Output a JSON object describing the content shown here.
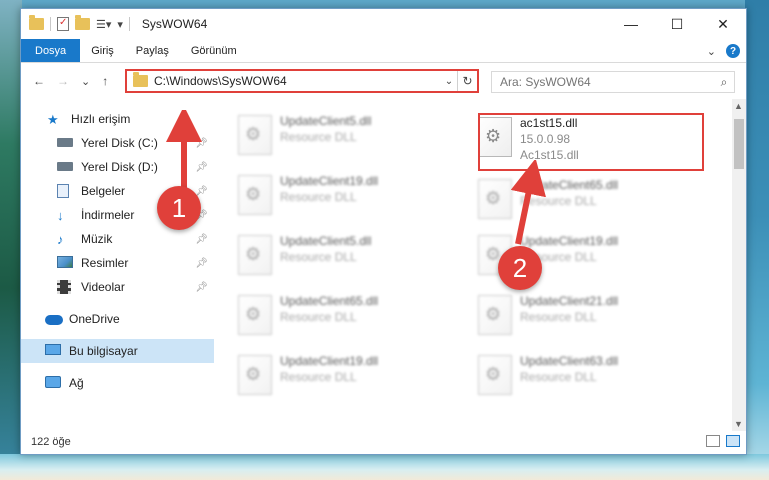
{
  "window": {
    "title": "SysWOW64",
    "controls": {
      "minimize": "—",
      "maximize": "☐",
      "close": "✕"
    }
  },
  "ribbon": {
    "tabs": [
      "Dosya",
      "Giriş",
      "Paylaş",
      "Görünüm"
    ]
  },
  "address": {
    "path": "C:\\Windows\\SysWOW64",
    "search_placeholder": "Ara: SysWOW64"
  },
  "navpane": {
    "items": [
      {
        "label": "Hızlı erişim",
        "icon": "star-icon",
        "pinned": false
      },
      {
        "label": "Yerel Disk (C:)",
        "icon": "drive-icon",
        "pinned": true
      },
      {
        "label": "Yerel Disk (D:)",
        "icon": "drive-icon",
        "pinned": true
      },
      {
        "label": "Belgeler",
        "icon": "documents-icon",
        "pinned": true
      },
      {
        "label": "İndirmeler",
        "icon": "download-icon",
        "pinned": true
      },
      {
        "label": "Müzik",
        "icon": "music-icon",
        "pinned": true
      },
      {
        "label": "Resimler",
        "icon": "pictures-icon",
        "pinned": true
      },
      {
        "label": "Videolar",
        "icon": "video-icon",
        "pinned": true
      },
      {
        "label": "OneDrive",
        "icon": "onedrive-icon",
        "pinned": false
      },
      {
        "label": "Bu bilgisayar",
        "icon": "this-pc-icon",
        "pinned": false,
        "selected": true
      },
      {
        "label": "Ağ",
        "icon": "network-icon",
        "pinned": false
      }
    ]
  },
  "files": {
    "left_column": [
      {
        "name": "UpdateClient5.dll",
        "type": "Resource DLL"
      },
      {
        "name": "UpdateClient19.dll",
        "type": "Resource DLL"
      },
      {
        "name": "UpdateClient5.dll",
        "type": "Resource DLL"
      },
      {
        "name": "UpdateClient65.dll",
        "type": "Resource DLL"
      },
      {
        "name": "UpdateClient19.dll",
        "type": "Resource DLL"
      }
    ],
    "right_column": [
      {
        "name": "ac1st15.dll",
        "version": "15.0.0.98",
        "description": "Ac1st15.dll"
      },
      {
        "name": "UpdateClient65.dll",
        "type": "Resource DLL"
      },
      {
        "name": "UpdateClient19.dll",
        "type": "Resource DLL"
      },
      {
        "name": "UpdateClient21.dll",
        "type": "Resource DLL"
      },
      {
        "name": "UpdateClient63.dll",
        "type": "Resource DLL"
      }
    ]
  },
  "status": {
    "item_count": "122 öğe"
  },
  "callouts": {
    "first": "1",
    "second": "2"
  },
  "colors": {
    "accent": "#1979ca",
    "highlight": "#e0403a"
  }
}
